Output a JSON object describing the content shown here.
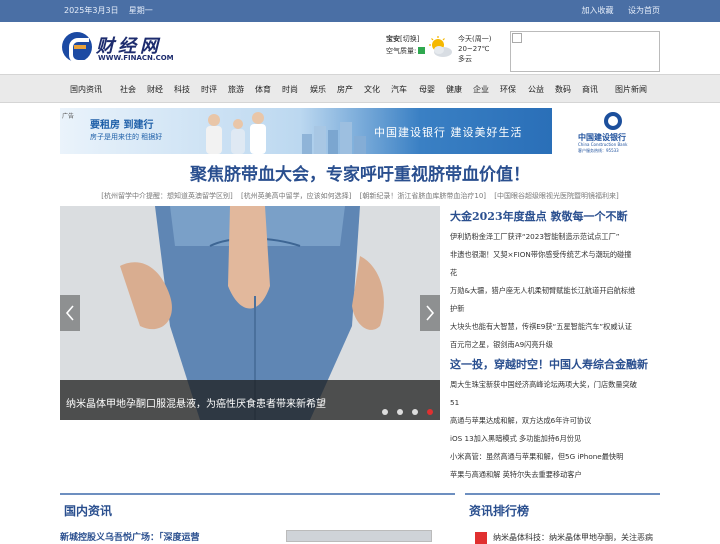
{
  "topbar": {
    "date": "2025年3月3日",
    "weekday": "星期一",
    "fav": "加入收藏",
    "home": "设为首页"
  },
  "logo": {
    "cn": "财经网",
    "en": "WWW.FINACN.COM"
  },
  "weather": {
    "city": "宝安",
    "city_tag": "[切换]",
    "air": "空气质量:",
    "today": "今天(周一)",
    "temp": "20~27℃",
    "desc": "多云"
  },
  "nav": [
    "国内资讯",
    "社会",
    "财经",
    "科技",
    "时评",
    "旅游",
    "体育",
    "时尚",
    "娱乐",
    "房产",
    "文化",
    "汽车",
    "母婴",
    "健康",
    "企业",
    "环保",
    "公益",
    "数码",
    "商讯",
    "图片新闻"
  ],
  "banner": {
    "tag": "广告",
    "line1": "要租房 到建行",
    "line2": "房子是用来住的 租据好",
    "slogan": "中国建设银行 建设美好生活",
    "bank_cn": "中国建设银行",
    "bank_en": "China Construction Bank",
    "bank_tel": "客户服务热线：95533"
  },
  "headline": "聚焦脐带血大会，专家呼吁重视脐带血价值！",
  "sublinks": [
    "[杭州留学中介提醒：想知道英澳留学区别]",
    "[杭州英美高中留学，应该如何选择]",
    "[朝新纪录！浙江省脐血库脐带血治疗10]",
    "[中国眼谷超级眼视光医院暨明镜福利来]"
  ],
  "slider": {
    "caption": "纳米晶体甲地孕酮口服混悬液，为癌性厌食患者带来新希望",
    "dot_count": 4,
    "active_dot": 3
  },
  "news": [
    {
      "type": "big",
      "text": "大金2023年度盘点 敦敬每一个不断"
    },
    {
      "type": "item",
      "text": "伊利奶粉金泽工厂获评“2023智能制造示范试点工厂”"
    },
    {
      "type": "item",
      "text": "非遗也很潮！又契×FION带你感受传统艺术与潮玩的碰撞"
    },
    {
      "type": "item",
      "text": "花"
    },
    {
      "type": "item",
      "text": "万勋&大疆，猎户座无人机柔韧臂赋能长江航道开启航标维"
    },
    {
      "type": "item",
      "text": "护新"
    },
    {
      "type": "item",
      "text": "大块头也能有大智慧，传祺E9获“五星智能汽车”权威认证"
    },
    {
      "type": "item",
      "text": "百元帘之星，银剑南A9闪亮升级"
    },
    {
      "type": "big",
      "text": "这一投，穿越时空！中国人寿综合金融新"
    },
    {
      "type": "item",
      "text": "周大生珠宝新获中国经济高峰论坛两项大奖，门店数量突破"
    },
    {
      "type": "item",
      "text": "51"
    },
    {
      "type": "item",
      "text": "高通与苹果达成和解，双方达成6年许可协议"
    },
    {
      "type": "item",
      "text": "iOS 13加入黑暗模式 多功能加持6月份见"
    },
    {
      "type": "item",
      "text": "小米高管：虽然高通与苹果和解，但5G iPhone最快明"
    },
    {
      "type": "item",
      "text": "苹果与高通和解 英特尔失去重要移动客户"
    }
  ],
  "section_domestic": {
    "title": "国内资讯",
    "lead": "新城控股义乌吾悦广场：「深度运营"
  },
  "section_rank": {
    "title": "资讯排行榜",
    "first": "纳米晶体科技：纳米晶体甲地孕酮，关注恶病"
  }
}
